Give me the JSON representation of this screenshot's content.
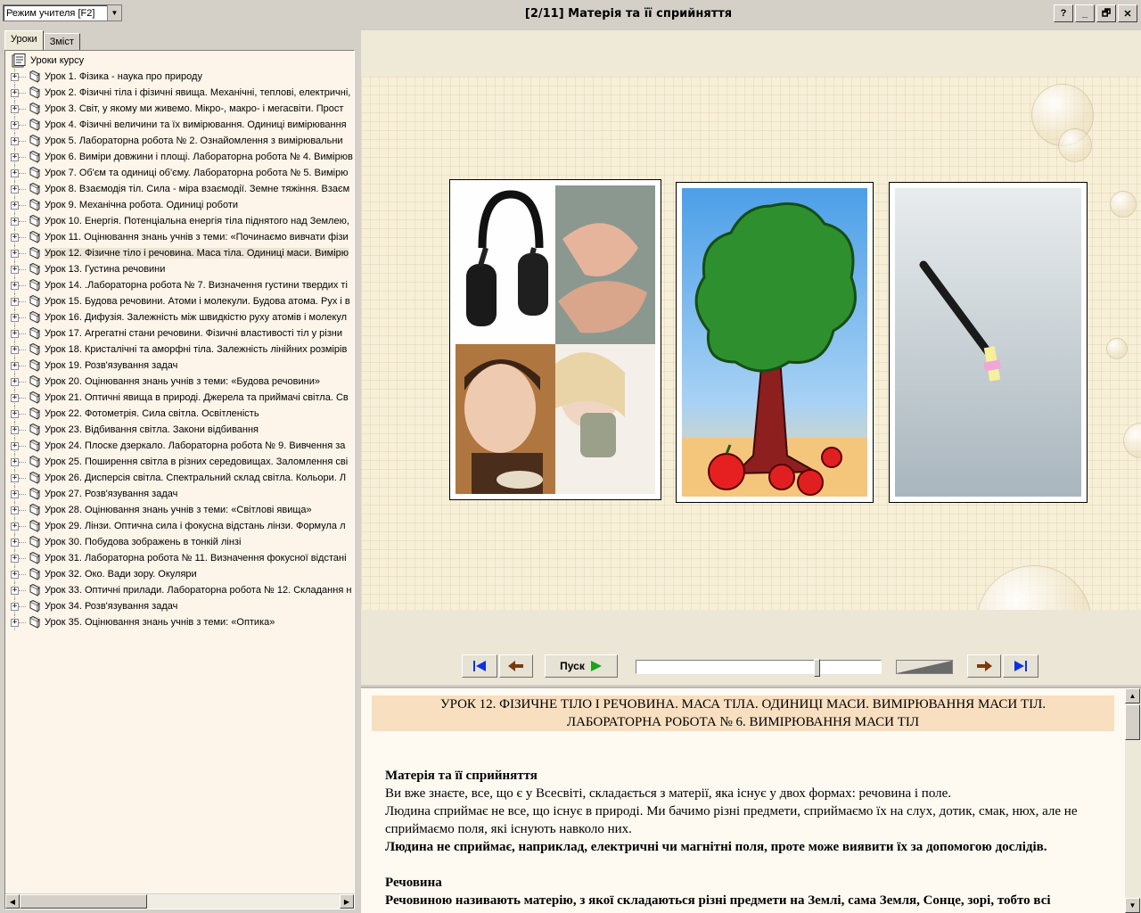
{
  "window": {
    "title": "[2/11] Матерія та її сприйняття",
    "mode_select": "Режим учителя [F2]",
    "buttons": [
      "?",
      "_",
      "🗗",
      "✕"
    ]
  },
  "tabs": [
    "Уроки",
    "Зміст"
  ],
  "tree": {
    "root": "Уроки курсу",
    "selected_index": 11,
    "items": [
      "Урок 1. Фізика - наука про природу",
      "Урок 2. Фізичні тіла і фізичні явища. Механічні, теплові, електричні,",
      "Урок 3. Світ, у якому ми живемо. Мікро-, макро- і мегасвіти. Прост",
      "Урок 4. Фізичні величини та їх вимірювання. Одиниці вимірювання",
      "Урок 5. Лабораторна робота № 2. Ознайомлення з вимірювальни",
      "Урок 6. Виміри довжини і площі. Лабораторна робота № 4. Вимірюв",
      "Урок 7. Об'єм та одиниці об'єму. Лабораторна робота № 5. Вимірю",
      "Урок 8. Взаємодія тіл. Сила - міра взаємодії. Земне тяжіння. Взаєм",
      "Урок 9. Механічна робота. Одиниці роботи",
      "Урок 10. Енергія. Потенціальна енергія тіла піднятого над Землею,",
      "Урок 11. Оцінювання знань учнів з теми: «Починаємо вивчати фізи",
      "Урок 12. Фізичне тіло і речовина. Маса тіла. Одиниці маси. Вимірю",
      "Урок 13. Густина речовини",
      "Урок 14. .Лабораторна робота № 7. Визначення густини твердих ті",
      "Урок 15. Будова речовини. Атоми і молекули. Будова атома. Рух і в",
      "Урок 16. Дифузія. Залежність між швидкістю руху атомів і молекул",
      "Урок 17. Агрегатні стани речовини. Фізичні властивості тіл у різни",
      "Урок 18. Кристалічні та аморфні тіла. Залежність лінійних розмірів",
      "Урок 19. Розв'язування задач",
      "Урок 20. Оцінювання знань учнів з теми: «Будова речовини»",
      "Урок 21. Оптичні явища в природі. Джерела та приймачі світла. Св",
      "Урок 22. Фотометрія. Сила світла. Освітленість",
      "Урок 23. Відбивання світла. Закони відбивання",
      "Урок 24. Плоске дзеркало. Лабораторна робота № 9. Вивчення за",
      "Урок 25. Поширення світла в різних середовищах. Заломлення сві",
      "Урок 26. Дисперсія світла. Спектральний склад світла. Кольори. Л",
      "Урок 27. Розв'язування задач",
      "Урок 28. Оцінювання знань учнів з теми: «Світлові явища»",
      "Урок 29. Лінзи. Оптична сила і фокусна відстань лінзи. Формула л",
      "Урок 30. Побудова зображень в тонкій лінзі",
      "Урок 31. Лабораторна робота № 11. Визначення фокусної відстані",
      "Урок 32. Око. Вади зору. Окуляри",
      "Урок 33. Оптичні прилади. Лабораторна робота № 12. Складання н",
      "Урок 34. Розв'язування задач",
      "Урок 35. Оцінювання знань учнів з теми: «Оптика»"
    ]
  },
  "player": {
    "play_label": "Пуск",
    "progress": 0.75
  },
  "content": {
    "heading_line1": "УРОК 12. ФІЗИЧНЕ ТІЛО І РЕЧОВИНА. МАСА ТІЛА. ОДИНИЦІ МАСИ. ВИМІРЮВАННЯ МАСИ ТІЛ.",
    "heading_line2": "ЛАБОРАТОРНА РОБОТА № 6. ВИМІРЮВАННЯ МАСИ ТІЛ",
    "section1_title": "Матерія та її сприйняття",
    "p1": "Ви вже знаєте, все, що є у Всесвіті, складається з матерії, яка існує у двох формах: речовина і поле.",
    "p2": "Людина сприймає не все, що існує в природі. Ми бачимо різні предмети, сприймаємо їх на слух, дотик, смак, нюх, але не сприймаємо поля, які існують навколо них.",
    "p3": "Людина не сприймає, наприклад, електричні чи магнітні поля, проте може виявити їх за допомогою дослідів.",
    "section2_title": "Речовина",
    "p4": "Речовиною називають матерію, з якої складаються різні предмети на Землі, сама Земля, Сонце, зорі, тобто всі"
  },
  "colors": {
    "heading_bg": "#f8dfc0",
    "panel_bg": "#fdf5ea",
    "accent_green": "#1aa51a",
    "accent_blue": "#1030e0"
  }
}
